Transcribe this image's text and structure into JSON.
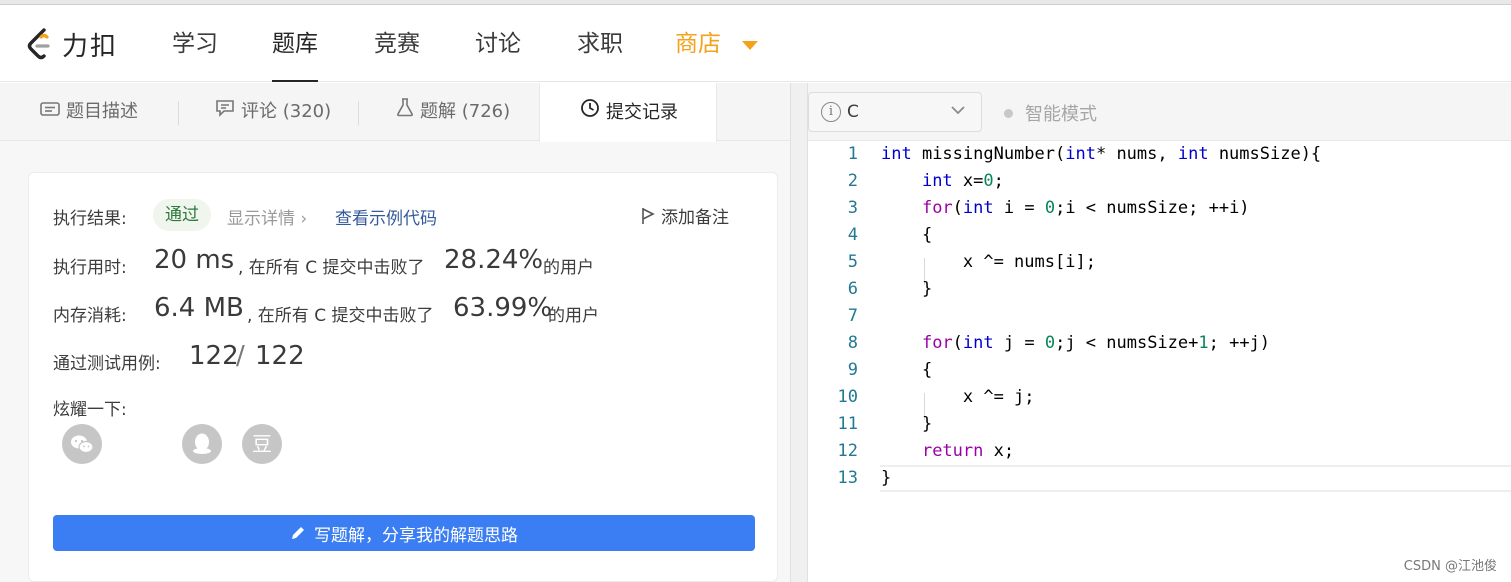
{
  "nav": {
    "logo": "力扣",
    "items": [
      "学习",
      "题库",
      "竞赛",
      "讨论",
      "求职",
      "商店"
    ],
    "active": "题库"
  },
  "tabs": [
    {
      "label": "题目描述",
      "icon": "description-icon"
    },
    {
      "label": "评论 (320)",
      "icon": "comment-icon"
    },
    {
      "label": "题解 (726)",
      "icon": "flask-icon"
    },
    {
      "label": "提交记录",
      "icon": "clock-icon",
      "active": true
    }
  ],
  "result": {
    "label": "执行结果:",
    "status": "通过",
    "detail": "显示详情 ›",
    "example": "查看示例代码",
    "note": "添加备注",
    "runtime_label": "执行用时:",
    "runtime_value": "20 ms",
    "runtime_beat_text": ", 在所有 C 提交中击败了",
    "runtime_percent": "28.24%",
    "users": "的用户",
    "memory_label": "内存消耗:",
    "memory_value": "6.4 MB",
    "memory_beat_text": ", 在所有 C 提交中击败了",
    "memory_percent": "63.99%",
    "tests_label": "通过测试用例:",
    "tests_passed": "122",
    "tests_sep": "/",
    "tests_total": "122",
    "share_label": "炫耀一下:",
    "share_icons": [
      "wechat-icon",
      "qq-icon",
      "douban-icon"
    ],
    "douban_glyph": "豆",
    "write_button": "写题解，分享我的解题思路"
  },
  "editor": {
    "language": "C",
    "smart_mode": "智能模式",
    "lines": [
      "int missingNumber(int* nums, int numsSize){",
      "    int x=0;",
      "    for(int i = 0;i < numsSize; ++i)",
      "    {",
      "        x ^= nums[i];",
      "    }",
      "",
      "    for(int j = 0;j < numsSize+1; ++j)",
      "    {",
      "        x ^= j;",
      "    }",
      "    return x;",
      "}"
    ],
    "line_numbers": [
      "1",
      "2",
      "3",
      "4",
      "5",
      "6",
      "7",
      "8",
      "9",
      "10",
      "11",
      "12",
      "13"
    ]
  },
  "watermark": "CSDN @江池俊",
  "colors": {
    "accent_blue": "#3b7ef3",
    "shop_orange": "#f5a11b",
    "pass_green": "#2d7a3a"
  }
}
